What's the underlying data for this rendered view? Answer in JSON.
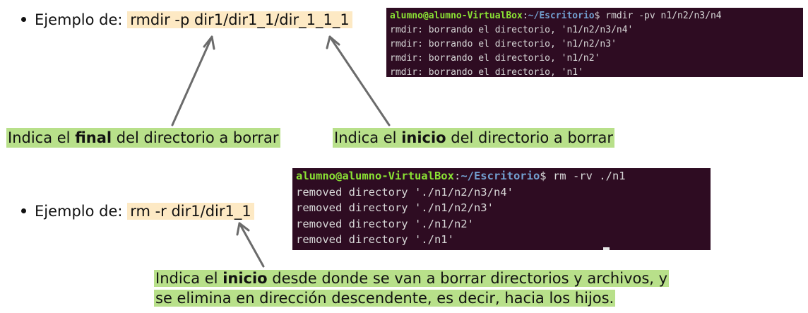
{
  "example1": {
    "prefix": "Ejemplo de:",
    "command": "rmdir -p dir1/dir1_1/dir_1_1_1"
  },
  "terminal1": {
    "user": "alumno@alumno-VirtualBox",
    "sep": ":",
    "path": "~/Escritorio",
    "prompt": "$ rmdir -pv n1/n2/n3/n4",
    "lines": [
      "rmdir: borrando el directorio, 'n1/n2/n3/n4'",
      "rmdir: borrando el directorio, 'n1/n2/n3'",
      "rmdir: borrando el directorio, 'n1/n2'",
      "rmdir: borrando el directorio, 'n1'"
    ]
  },
  "note_final": {
    "before": "Indica el ",
    "bold": "final",
    "after": " del directorio a borrar"
  },
  "note_inicio": {
    "before": "Indica el ",
    "bold": "inicio",
    "after": " del directorio a borrar"
  },
  "example2": {
    "prefix": "Ejemplo de:",
    "command": "rm -r dir1/dir1_1"
  },
  "terminal2": {
    "user": "alumno@alumno-VirtualBox",
    "sep": ":",
    "path": "~/Escritorio",
    "prompt": "$ rm -rv ./n1",
    "lines": [
      "removed directory './n1/n2/n3/n4'",
      "removed directory './n1/n2/n3'",
      "removed directory './n1/n2'",
      "removed directory './n1'"
    ]
  },
  "note_rm": {
    "line1_before": "Indica el ",
    "line1_bold": "inicio",
    "line1_after": " desde donde se van a borrar directorios y archivos, y",
    "line2": "se elimina en dirección descendente, es decir, hacia los hijos."
  },
  "colors": {
    "command_highlight": "#fde9c4",
    "note_highlight": "#b8e08a",
    "terminal_bg": "#2e0c22",
    "terminal_user": "#8ae234",
    "terminal_path": "#729fcf",
    "arrow": "#6b6b6b"
  }
}
